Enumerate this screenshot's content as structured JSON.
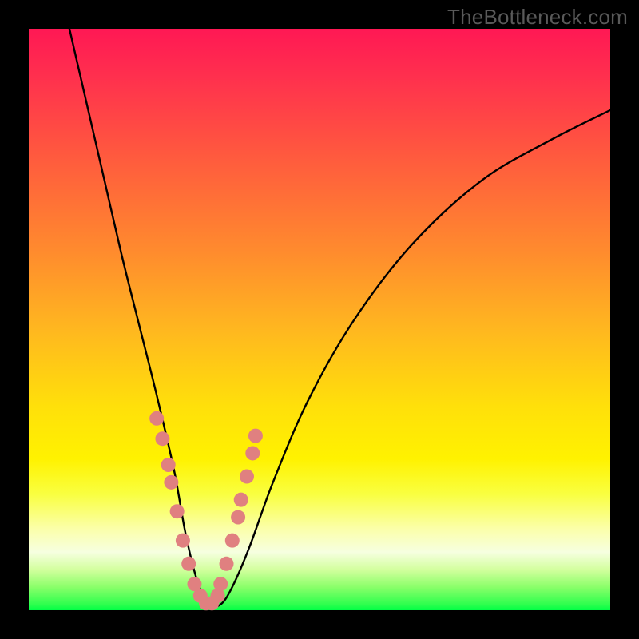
{
  "watermark": "TheBottleneck.com",
  "chart_data": {
    "type": "line",
    "title": "",
    "xlabel": "",
    "ylabel": "",
    "xlim": [
      0,
      100
    ],
    "ylim": [
      0,
      100
    ],
    "grid": false,
    "legend": false,
    "annotations": [],
    "gradient_bands": [
      {
        "color": "red",
        "y_range": [
          60,
          100
        ]
      },
      {
        "color": "orange",
        "y_range": [
          30,
          60
        ]
      },
      {
        "color": "yellow",
        "y_range": [
          8,
          30
        ]
      },
      {
        "color": "green",
        "y_range": [
          0,
          8
        ]
      }
    ],
    "series": [
      {
        "name": "bottleneck-curve",
        "x": [
          7,
          10,
          13,
          16,
          19,
          22,
          25,
          27,
          29,
          31,
          33,
          35,
          38,
          42,
          48,
          56,
          66,
          78,
          90,
          100
        ],
        "y": [
          100,
          87,
          74,
          61,
          49,
          37,
          24,
          13,
          5,
          1,
          1,
          4,
          11,
          22,
          36,
          50,
          63,
          74,
          81,
          86
        ]
      }
    ],
    "scatter": [
      {
        "name": "curve-markers",
        "x": [
          22.0,
          23.0,
          24.0,
          24.5,
          25.5,
          26.5,
          27.5,
          28.5,
          29.5,
          30.5,
          31.5,
          32.5,
          33.0,
          34.0,
          35.0,
          36.0,
          36.5,
          37.5,
          38.5,
          39.0
        ],
        "y": [
          33.0,
          29.5,
          25.0,
          22.0,
          17.0,
          12.0,
          8.0,
          4.5,
          2.5,
          1.2,
          1.2,
          2.5,
          4.5,
          8.0,
          12.0,
          16.0,
          19.0,
          23.0,
          27.0,
          30.0
        ]
      }
    ],
    "curve_minimum_x": 31,
    "notes": "V-shaped bottleneck curve on a traffic-light gradient background. Minimum (optimal/no-bottleneck) around x≈31. Pink circular markers cluster along the lower portion of the V on both sides. No axis ticks, labels, title, or legend are rendered."
  }
}
